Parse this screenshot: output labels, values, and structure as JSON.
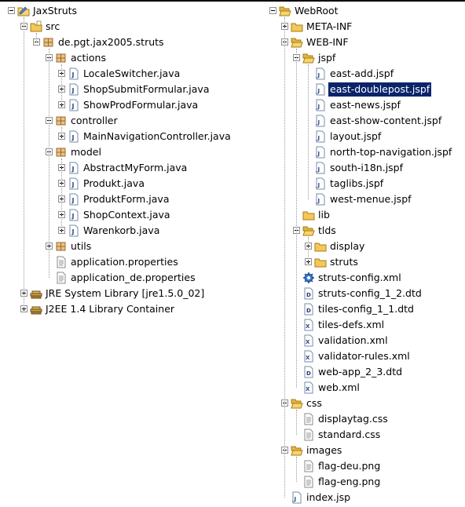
{
  "left_tree": [
    {
      "depth": 0,
      "toggle": "minus",
      "icon": "java-project-icon",
      "label": "JaxStruts"
    },
    {
      "depth": 1,
      "toggle": "minus",
      "icon": "source-folder-icon",
      "label": "src"
    },
    {
      "depth": 2,
      "toggle": "minus",
      "icon": "package-icon",
      "label": "de.pgt.jax2005.struts"
    },
    {
      "depth": 3,
      "toggle": "minus",
      "icon": "package-icon",
      "label": "actions"
    },
    {
      "depth": 4,
      "toggle": "plus",
      "icon": "java-file-icon",
      "label": "LocaleSwitcher.java"
    },
    {
      "depth": 4,
      "toggle": "plus",
      "icon": "java-file-icon",
      "label": "ShopSubmitFormular.java"
    },
    {
      "depth": 4,
      "toggle": "plus",
      "icon": "java-file-icon",
      "label": "ShowProdFormular.java"
    },
    {
      "depth": 3,
      "toggle": "minus",
      "icon": "package-icon",
      "label": "controller"
    },
    {
      "depth": 4,
      "toggle": "plus",
      "icon": "java-file-icon",
      "label": "MainNavigationController.java"
    },
    {
      "depth": 3,
      "toggle": "minus",
      "icon": "package-icon",
      "label": "model"
    },
    {
      "depth": 4,
      "toggle": "plus",
      "icon": "java-file-icon",
      "label": "AbstractMyForm.java"
    },
    {
      "depth": 4,
      "toggle": "plus",
      "icon": "java-file-icon",
      "label": "Produkt.java"
    },
    {
      "depth": 4,
      "toggle": "plus",
      "icon": "java-file-icon",
      "label": "ProduktForm.java"
    },
    {
      "depth": 4,
      "toggle": "plus",
      "icon": "java-file-icon",
      "label": "ShopContext.java"
    },
    {
      "depth": 4,
      "toggle": "plus",
      "icon": "java-file-icon",
      "label": "Warenkorb.java"
    },
    {
      "depth": 3,
      "toggle": "plus",
      "icon": "package-icon",
      "label": "utils"
    },
    {
      "depth": 3,
      "toggle": "none",
      "icon": "properties-file-icon",
      "label": "application.properties"
    },
    {
      "depth": 3,
      "toggle": "none",
      "icon": "properties-file-icon",
      "label": "application_de.properties"
    },
    {
      "depth": 1,
      "toggle": "plus",
      "icon": "library-icon",
      "label": "JRE System Library [jre1.5.0_02]"
    },
    {
      "depth": 1,
      "toggle": "plus",
      "icon": "library-icon",
      "label": "J2EE 1.4 Library Container"
    }
  ],
  "right_tree": [
    {
      "depth": 0,
      "toggle": "minus",
      "icon": "folder-open-icon",
      "label": "WebRoot"
    },
    {
      "depth": 1,
      "toggle": "plus",
      "icon": "folder-icon",
      "label": "META-INF"
    },
    {
      "depth": 1,
      "toggle": "minus",
      "icon": "folder-open-icon",
      "label": "WEB-INF"
    },
    {
      "depth": 2,
      "toggle": "minus",
      "icon": "folder-open-icon",
      "label": "jspf"
    },
    {
      "depth": 3,
      "toggle": "none",
      "icon": "jsp-file-icon",
      "label": "east-add.jspf"
    },
    {
      "depth": 3,
      "toggle": "none",
      "icon": "jsp-file-icon",
      "label": "east-doublepost.jspf",
      "selected": true
    },
    {
      "depth": 3,
      "toggle": "none",
      "icon": "jsp-file-icon",
      "label": "east-news.jspf"
    },
    {
      "depth": 3,
      "toggle": "none",
      "icon": "jsp-file-icon",
      "label": "east-show-content.jspf"
    },
    {
      "depth": 3,
      "toggle": "none",
      "icon": "jsp-file-icon",
      "label": "layout.jspf"
    },
    {
      "depth": 3,
      "toggle": "none",
      "icon": "jsp-file-icon",
      "label": "north-top-navigation.jspf"
    },
    {
      "depth": 3,
      "toggle": "none",
      "icon": "jsp-file-icon",
      "label": "south-i18n.jspf"
    },
    {
      "depth": 3,
      "toggle": "none",
      "icon": "jsp-file-icon",
      "label": "taglibs.jspf"
    },
    {
      "depth": 3,
      "toggle": "none",
      "icon": "jsp-file-icon",
      "label": "west-menue.jspf"
    },
    {
      "depth": 2,
      "toggle": "none",
      "icon": "folder-icon",
      "label": "lib"
    },
    {
      "depth": 2,
      "toggle": "minus",
      "icon": "folder-open-icon",
      "label": "tlds"
    },
    {
      "depth": 3,
      "toggle": "plus",
      "icon": "folder-icon",
      "label": "display"
    },
    {
      "depth": 3,
      "toggle": "plus",
      "icon": "folder-icon",
      "label": "struts"
    },
    {
      "depth": 2,
      "toggle": "none",
      "icon": "struts-config-icon",
      "label": "struts-config.xml"
    },
    {
      "depth": 2,
      "toggle": "none",
      "icon": "dtd-file-icon",
      "label": "struts-config_1_2.dtd"
    },
    {
      "depth": 2,
      "toggle": "none",
      "icon": "dtd-file-icon",
      "label": "tiles-config_1_1.dtd"
    },
    {
      "depth": 2,
      "toggle": "none",
      "icon": "xml-file-icon",
      "label": "tiles-defs.xml"
    },
    {
      "depth": 2,
      "toggle": "none",
      "icon": "xml-file-icon",
      "label": "validation.xml"
    },
    {
      "depth": 2,
      "toggle": "none",
      "icon": "xml-file-icon",
      "label": "validator-rules.xml"
    },
    {
      "depth": 2,
      "toggle": "none",
      "icon": "dtd-file-icon",
      "label": "web-app_2_3.dtd"
    },
    {
      "depth": 2,
      "toggle": "none",
      "icon": "xml-file-icon",
      "label": "web.xml"
    },
    {
      "depth": 1,
      "toggle": "minus",
      "icon": "folder-open-icon",
      "label": "css"
    },
    {
      "depth": 2,
      "toggle": "none",
      "icon": "text-file-icon",
      "label": "displaytag.css"
    },
    {
      "depth": 2,
      "toggle": "none",
      "icon": "text-file-icon",
      "label": "standard.css"
    },
    {
      "depth": 1,
      "toggle": "minus",
      "icon": "folder-open-icon",
      "label": "images"
    },
    {
      "depth": 2,
      "toggle": "none",
      "icon": "text-file-icon",
      "label": "flag-deu.png"
    },
    {
      "depth": 2,
      "toggle": "none",
      "icon": "text-file-icon",
      "label": "flag-eng.png"
    },
    {
      "depth": 1,
      "toggle": "none",
      "icon": "jsp-file-icon",
      "label": "index.jsp"
    }
  ],
  "colors": {
    "selection": "#0a246a",
    "folder": "#f0c24a",
    "java": "#3a5fa8",
    "package": "#b07a2a",
    "library": "#7a5a2a"
  }
}
